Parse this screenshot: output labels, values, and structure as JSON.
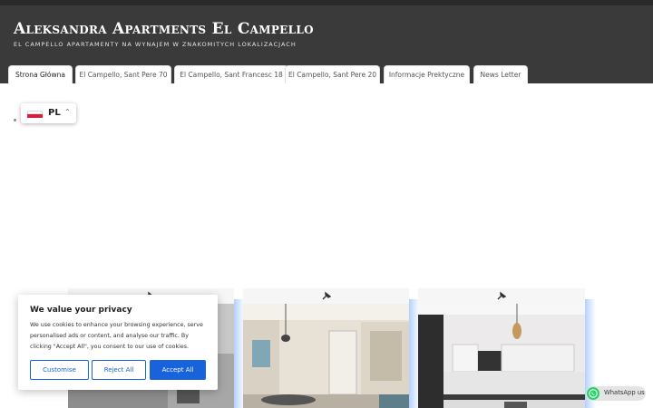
{
  "site": {
    "title": "Aleksandra Apartments El Campello",
    "tagline": "El Campello apartamenty na wynajem w znakomitych lokalizacjach"
  },
  "nav": {
    "tabs": [
      {
        "label": "Strona Główna",
        "active": true
      },
      {
        "label": "El Campello, Sant Pere 70",
        "active": false
      },
      {
        "label": "El Campello, Sant Francesc 18",
        "active": false
      },
      {
        "label": "El Campello, Sant Pere 20",
        "active": false
      },
      {
        "label": "Informacje Prektyczne",
        "active": false
      },
      {
        "label": "News Letter",
        "active": false
      }
    ]
  },
  "language": {
    "code": "PL",
    "flag": "poland-flag",
    "chevron": "chevron-up-icon"
  },
  "cards": [
    {
      "icon": "pin-icon",
      "photo": "apartment-photo"
    },
    {
      "icon": "pin-icon",
      "photo": "apartment-living-room-photo"
    },
    {
      "icon": "pin-icon",
      "photo": "apartment-kitchen-photo"
    }
  ],
  "cookie": {
    "title": "We value your privacy",
    "text": "We use cookies to enhance your browsing experience, serve personalised ads or content, and analyse our traffic. By clicking \"Accept All\", you consent to our use of cookies.",
    "customise_label": "Customise",
    "reject_label": "Reject All",
    "accept_label": "Accept All"
  },
  "whatsapp": {
    "label": "WhatsApp us",
    "icon": "whatsapp-icon"
  },
  "colors": {
    "header": "#3a3a3a",
    "accent": "#1863dc",
    "whatsapp": "#25d366"
  }
}
